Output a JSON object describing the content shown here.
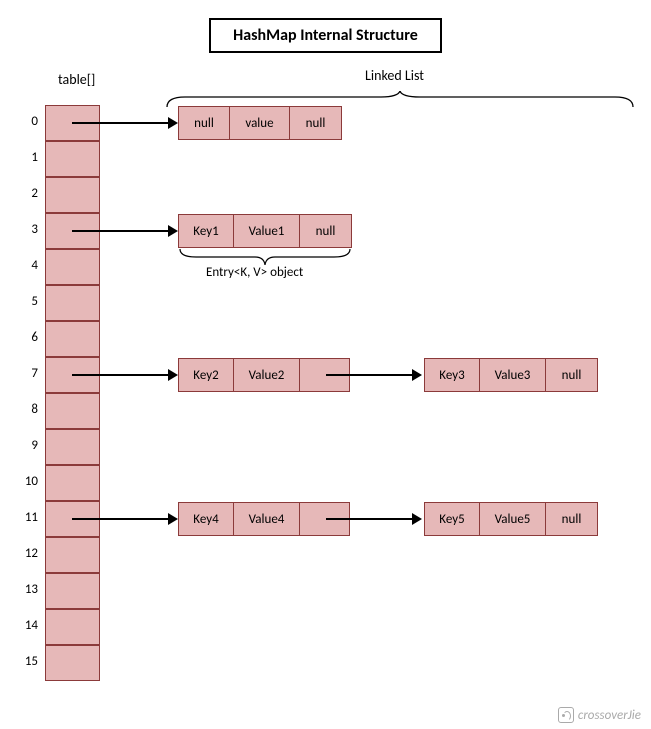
{
  "title": "HashMap Internal Structure",
  "labels": {
    "table": "table[]",
    "linked_list": "Linked List",
    "entry_object": "Entry<K, V> object"
  },
  "buckets": {
    "count": 16,
    "indices": [
      "0",
      "1",
      "2",
      "3",
      "4",
      "5",
      "6",
      "7",
      "8",
      "9",
      "10",
      "11",
      "12",
      "13",
      "14",
      "15"
    ]
  },
  "chains": {
    "r0": {
      "n1": {
        "key": "null",
        "value": "value",
        "next": "null"
      }
    },
    "r3": {
      "n1": {
        "key": "Key1",
        "value": "Value1",
        "next": "null"
      }
    },
    "r7": {
      "n1": {
        "key": "Key2",
        "value": "Value2",
        "next": ""
      },
      "n2": {
        "key": "Key3",
        "value": "Value3",
        "next": "null"
      }
    },
    "r11": {
      "n1": {
        "key": "Key4",
        "value": "Value4",
        "next": ""
      },
      "n2": {
        "key": "Key5",
        "value": "Value5",
        "next": "null"
      }
    }
  },
  "watermark": "crossoverJie"
}
